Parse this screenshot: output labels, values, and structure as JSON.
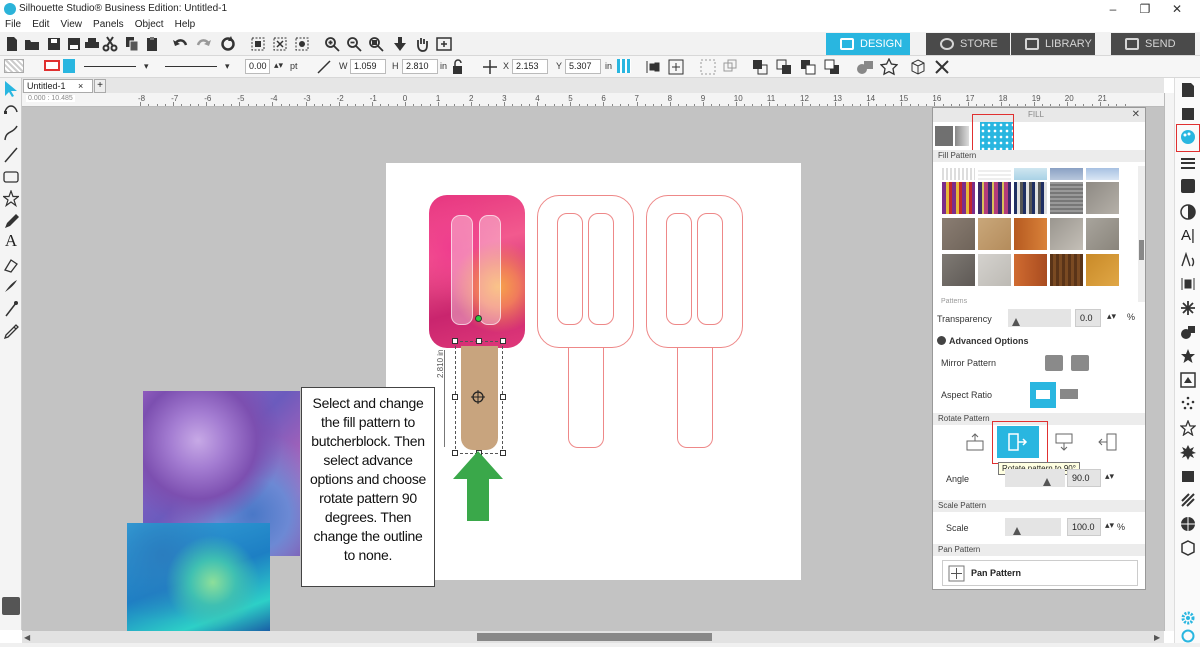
{
  "titlebar": {
    "title": "Silhouette Studio® Business Edition: Untitled-1",
    "minimize": "–",
    "restore": "❐",
    "close": "✕"
  },
  "menu": [
    "File",
    "Edit",
    "View",
    "Panels",
    "Object",
    "Help"
  ],
  "nav_tabs": {
    "design": "DESIGN",
    "store": "STORE",
    "library": "LIBRARY",
    "send": "SEND"
  },
  "toolbar2": {
    "line_width": "0.00",
    "line_unit": "pt",
    "w_label": "W",
    "w_value": "1.059",
    "h_label": "H",
    "h_value": "2.810",
    "h_unit": "in",
    "x_label": "X",
    "x_value": "2.153",
    "y_label": "Y",
    "y_value": "5.307",
    "y_unit": "in"
  },
  "document_tab": {
    "label": "Untitled-1",
    "close": "×",
    "add": "+"
  },
  "ruler_numbers": [
    "-8",
    "-7",
    "-6",
    "-5",
    "-4",
    "-3",
    "-2",
    "-1",
    "0",
    "1",
    "2",
    "3",
    "4",
    "5",
    "6",
    "7",
    "8",
    "9",
    "10",
    "11",
    "12",
    "13",
    "14",
    "15",
    "16",
    "17",
    "18",
    "19",
    "20",
    "21"
  ],
  "ruler_readout": "0.000 : 10.485",
  "selection_height_label": "2.810 in",
  "callout_text": "Select and change the fill pattern to butcherblock. Then select advance options and choose rotate pattern 90 degrees. Then change the outline to none.",
  "panel": {
    "header": "FILL",
    "fill_pattern_label": "Fill Pattern",
    "patterns_label": "Patterns",
    "transparency_label": "Transparency",
    "transparency_value": "0.0",
    "transparency_unit": "%",
    "advanced_options_label": "Advanced Options",
    "mirror_pattern_label": "Mirror Pattern",
    "aspect_ratio_label": "Aspect Ratio",
    "rotate_pattern_label": "Rotate Pattern",
    "tooltip": "Rotate pattern to 90°",
    "angle_label": "Angle",
    "angle_value": "90.0",
    "scale_pattern_label": "Scale Pattern",
    "scale_label": "Scale",
    "scale_value": "100.0",
    "scale_unit": "%",
    "pan_pattern_section": "Pan Pattern",
    "pan_pattern_button": "Pan Pattern"
  },
  "colors": {
    "accent": "#29b6e0",
    "callout_arrow": "#3aa84a",
    "highlight": "#e03030",
    "canvas": "#c3c3c3"
  }
}
